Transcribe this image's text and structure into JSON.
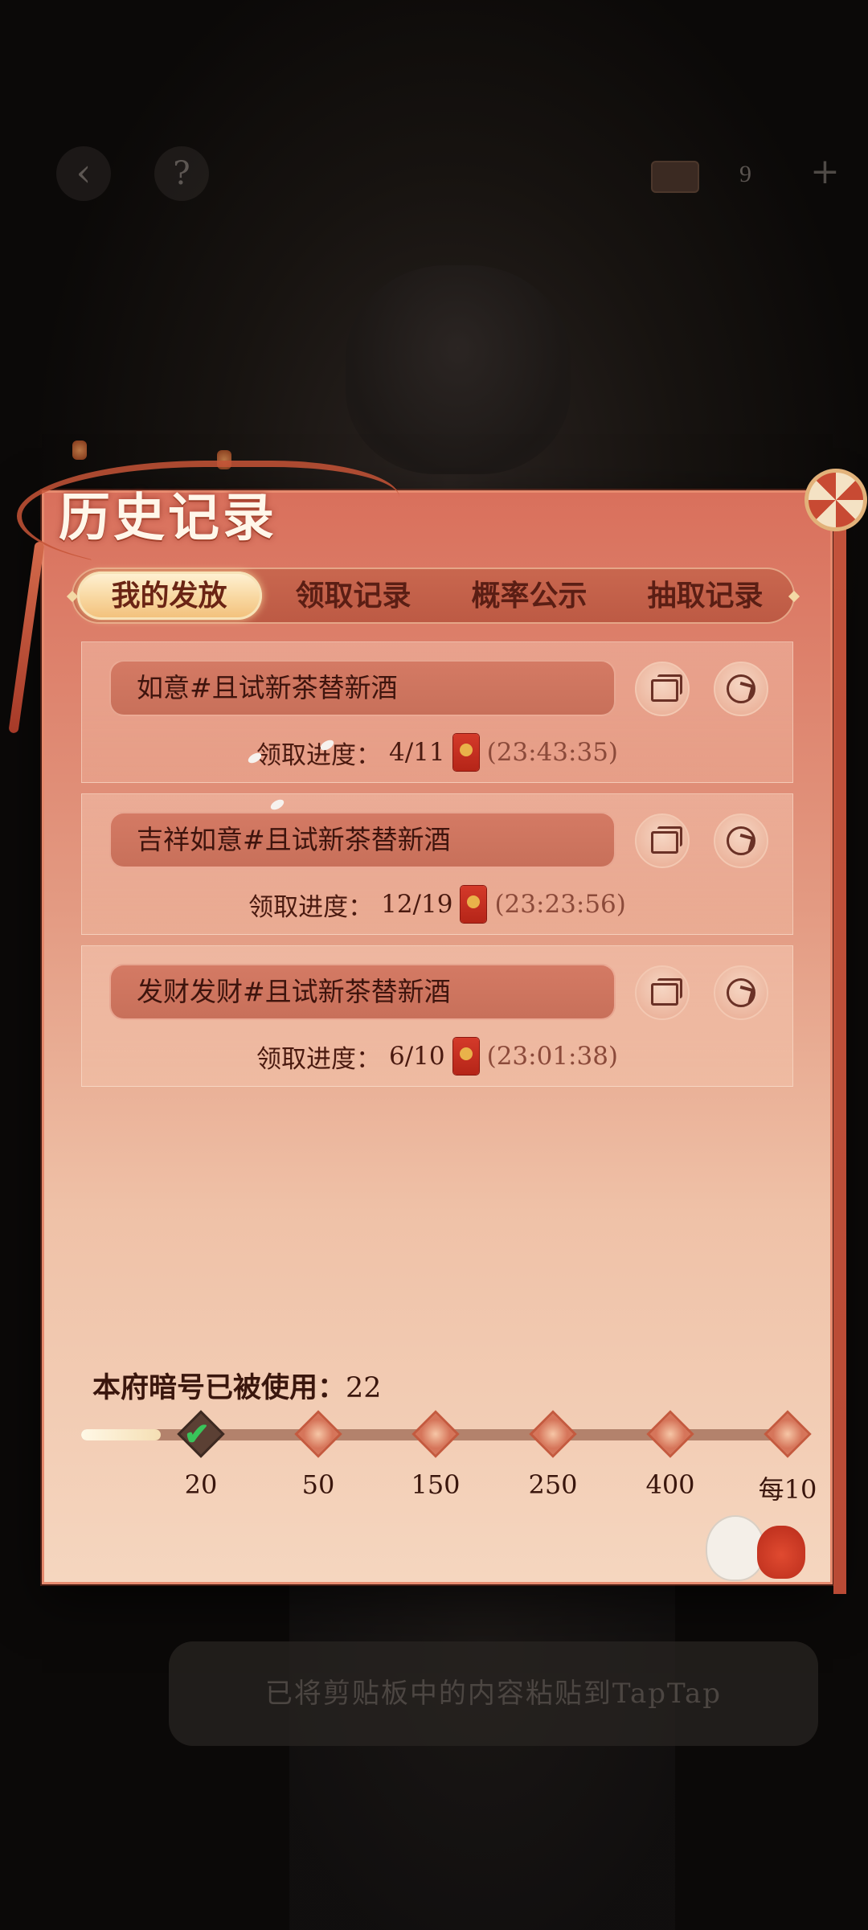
{
  "top_bar": {
    "back_icon": "back-arrow-icon",
    "help_glyph": "?",
    "currency_count": "9",
    "plus_glyph": "+"
  },
  "panel": {
    "title": "历史记录",
    "tabs": [
      "我的发放",
      "领取记录",
      "概率公示",
      "抽取记录"
    ],
    "active_tab": 0
  },
  "records": [
    {
      "code": "如意#且试新茶替新酒",
      "progress_label": "领取进度：",
      "progress": "4/11",
      "time": "(23:43:35)"
    },
    {
      "code": "吉祥如意#且试新茶替新酒",
      "progress_label": "领取进度：",
      "progress": "12/19",
      "time": "(23:23:56)"
    },
    {
      "code": "发财发财#且试新茶替新酒",
      "progress_label": "领取进度：",
      "progress": "6/10",
      "time": "(23:01:38)"
    }
  ],
  "usage": {
    "label": "本府暗号已被使用：",
    "value": "22",
    "progress_fraction": 0.11
  },
  "milestones": [
    "20",
    "50",
    "150",
    "250",
    "400",
    "每10"
  ],
  "toast": "已将剪贴板中的内容粘贴到TapTap",
  "colors": {
    "panel_top": "#d9705c",
    "panel_bottom": "#f5d6bf",
    "active_tab": "#f8d7a0",
    "check": "#39c45a"
  }
}
